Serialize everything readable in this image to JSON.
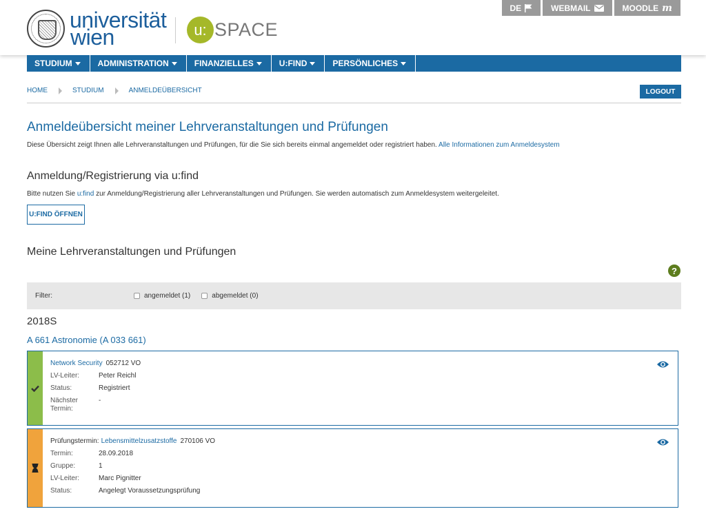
{
  "header": {
    "brand_line1": "universität",
    "brand_line2": "wien",
    "uspace_circle": "u:",
    "uspace_text": "SPACE",
    "toplinks": [
      "DE",
      "WEBMAIL",
      "MOODLE"
    ]
  },
  "nav": [
    "STUDIUM",
    "ADMINISTRATION",
    "FINANZIELLES",
    "U:FIND",
    "PERSÖNLICHES"
  ],
  "breadcrumb": [
    "HOME",
    "STUDIUM",
    "ANMELDEÜBERSICHT"
  ],
  "logout_label": "LOGOUT",
  "page": {
    "title": "Anmeldeübersicht meiner Lehrveranstaltungen und Prüfungen",
    "intro": "Diese Übersicht zeigt Ihnen alle Lehrveranstaltungen und Prüfungen, für die Sie sich bereits einmal angemeldet oder registriert haben.",
    "intro_link": "Alle Informationen zum Anmeldesystem",
    "sub_title": "Anmeldung/Registrierung via u:find",
    "sub_text_pre": "Bitte nutzen Sie",
    "sub_text_link": "u:find",
    "sub_text_post": "zur Anmeldung/Registrierung aller Lehrveranstaltungen und Prüfungen. Sie werden automatisch zum Anmeldesystem weitergeleitet.",
    "ufind_button": "U:FIND ÖFFNEN",
    "meine_title": "Meine Lehrveranstaltungen und Prüfungen",
    "help_glyph": "?"
  },
  "filter": {
    "label": "Filter:",
    "opt1": "angemeldet (1)",
    "opt2": "abgemeldet (0)"
  },
  "semester": "2018S",
  "studium_link": "A 661 Astronomie (A 033 661)",
  "cards": [
    {
      "title_link": "Network Security",
      "title_suffix": "052712 VO",
      "bar_color": "#8cbd4a",
      "icon": "check-icon",
      "rows": [
        {
          "key": "LV-Leiter:",
          "val": "Peter Reichl"
        },
        {
          "key": "Status:",
          "val": "Registriert"
        },
        {
          "key": "Nächster Termin:",
          "val": "-"
        }
      ]
    },
    {
      "title_prefix": "Prüfungstermin:",
      "title_link": "Lebensmittelzusatzstoffe",
      "title_suffix": "270106 VO",
      "bar_color": "#f0a33c",
      "icon": "hourglass-icon",
      "rows": [
        {
          "key": "Termin:",
          "val": "28.09.2018"
        },
        {
          "key": "Gruppe:",
          "val": "1"
        },
        {
          "key": "LV-Leiter:",
          "val": "Marc Pignitter"
        },
        {
          "key": "Status:",
          "val": "Angelegt Voraussetzungsprüfung"
        }
      ]
    }
  ]
}
